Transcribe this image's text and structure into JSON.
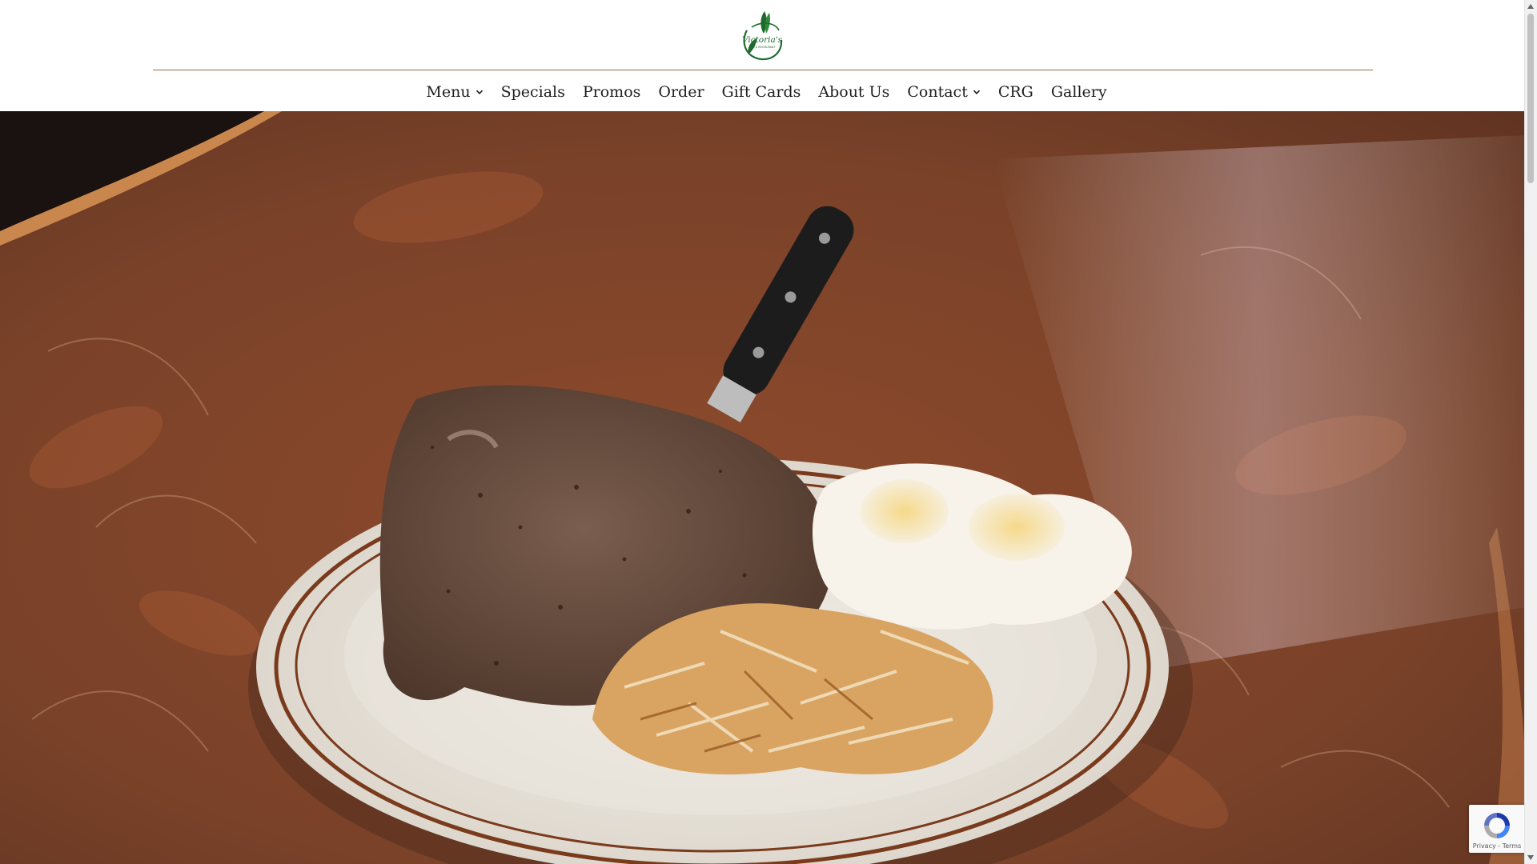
{
  "brand": {
    "logo_text": "Victoria's",
    "logo_subtext": "DELI & RESTAURANT",
    "accent_green": "#1f6b2f",
    "rule_color": "#9a6b45"
  },
  "nav": {
    "items": [
      {
        "label": "Menu",
        "has_dropdown": true
      },
      {
        "label": "Specials",
        "has_dropdown": false
      },
      {
        "label": "Promos",
        "has_dropdown": false
      },
      {
        "label": "Order",
        "has_dropdown": false
      },
      {
        "label": "Gift Cards",
        "has_dropdown": false
      },
      {
        "label": "About Us",
        "has_dropdown": false
      },
      {
        "label": "Contact",
        "has_dropdown": true
      },
      {
        "label": "CRG",
        "has_dropdown": false
      },
      {
        "label": "Gallery",
        "has_dropdown": false
      }
    ]
  },
  "hero": {
    "subject": "steak, eggs and hash browns plate on leaf-pattern table",
    "icon": "hero-food-image"
  },
  "recaptcha": {
    "links": "Privacy - Terms",
    "icon": "recaptcha-icon"
  }
}
